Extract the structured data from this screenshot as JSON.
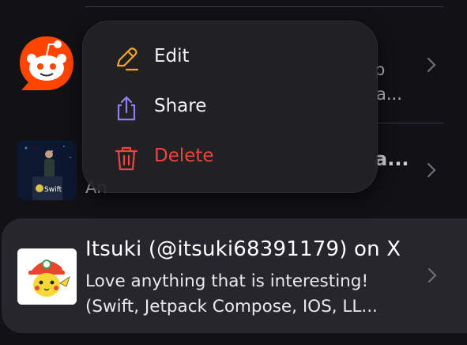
{
  "rows": [
    {
      "title": "",
      "subtitle_tail_1": "p",
      "subtitle_tail_2": "a...",
      "icon": "reddit-logo",
      "accent": "#ff4500"
    },
    {
      "title_tail": "a...",
      "subtitle_head": "An",
      "icon": "swift-conference-photo"
    }
  ],
  "focused_item": {
    "title": "Itsuki (@itsuki68391179) on X",
    "subtitle_line_1": "Love anything that is interesting!",
    "subtitle_line_2": "(Swift, Jetpack Compose, IOS, LL...",
    "icon": "pikachu-avatar"
  },
  "context_menu": {
    "items": [
      {
        "label": "Edit",
        "icon": "pencil-icon",
        "color": "#f5a623"
      },
      {
        "label": "Share",
        "icon": "share-icon",
        "color": "#8f7ef5"
      },
      {
        "label": "Delete",
        "icon": "trash-icon",
        "color": "#f0443c"
      }
    ]
  }
}
